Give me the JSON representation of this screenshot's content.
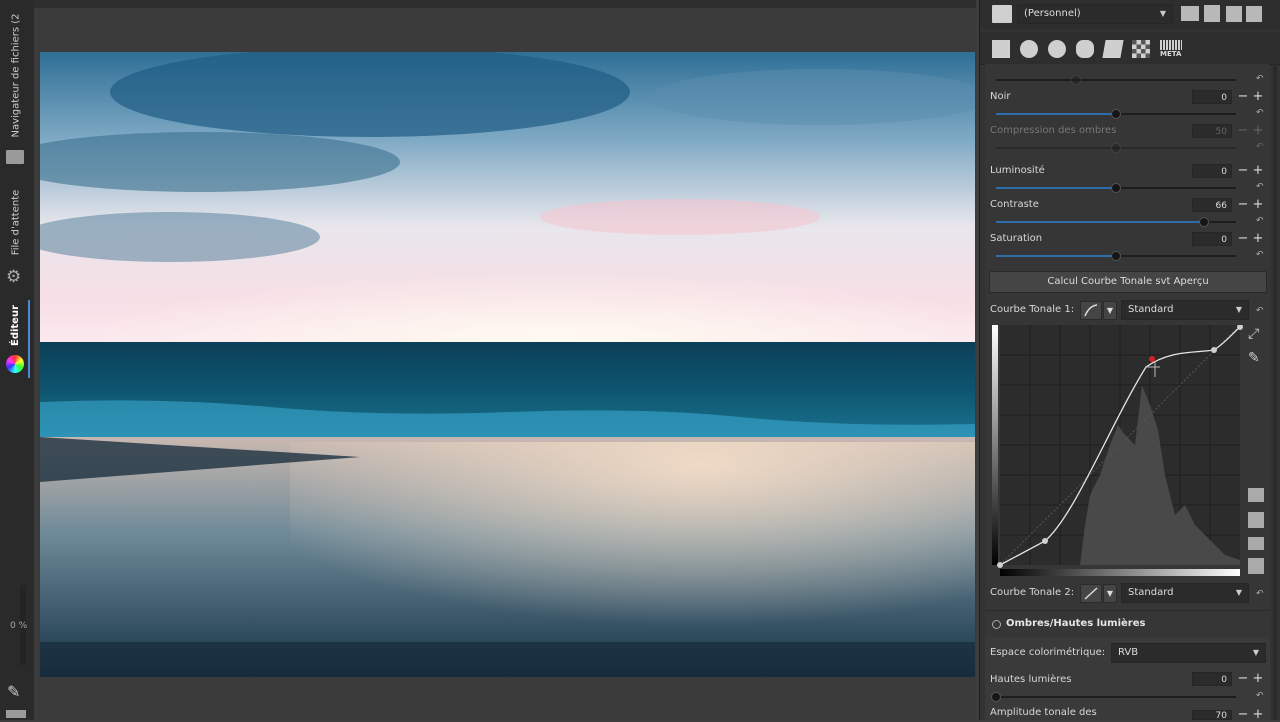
{
  "left_strip": {
    "tabs": [
      {
        "label": "Navigateur de fichiers (2"
      },
      {
        "label": "File d'attente"
      },
      {
        "label": "Éditeur"
      }
    ],
    "progress_label": "0 %"
  },
  "panel": {
    "profile": {
      "value": "(Personnel)"
    },
    "tool_tabs": [
      {
        "icon": "exposure-icon"
      },
      {
        "icon": "detail-icon"
      },
      {
        "icon": "color-icon"
      },
      {
        "icon": "advanced-icon"
      },
      {
        "icon": "transform-icon"
      },
      {
        "icon": "raw-icon"
      },
      {
        "label": "META",
        "icon": "metadata-icon"
      }
    ],
    "sliders": [
      {
        "label": "Noir",
        "value": "0",
        "fraction": 0.5,
        "enabled": true
      },
      {
        "label": "Compression des ombres",
        "value": "50",
        "fraction": 0.5,
        "enabled": false
      },
      {
        "label": "Luminosité",
        "value": "0",
        "fraction": 0.5,
        "enabled": true
      },
      {
        "label": "Contraste",
        "value": "66",
        "fraction": 0.83,
        "enabled": true
      },
      {
        "label": "Saturation",
        "value": "0",
        "fraction": 0.5,
        "enabled": true
      }
    ],
    "auto_curve_button": "Calcul Courbe Tonale svt Aperçu",
    "curve1": {
      "label": "Courbe Tonale 1:",
      "mode": "Standard"
    },
    "curve2": {
      "label": "Courbe Tonale 2:",
      "mode": "Standard"
    },
    "shadows_highlights": {
      "title": "Ombres/Hautes lumières",
      "colorspace_label": "Espace colorimétrique:",
      "colorspace_value": "RVB",
      "highlights_label": "Hautes lumières",
      "highlights_value": "0",
      "highlights_fraction": 0.0,
      "tonal_width_label": "Amplitude tonale des",
      "tonal_width_value": "70"
    }
  }
}
